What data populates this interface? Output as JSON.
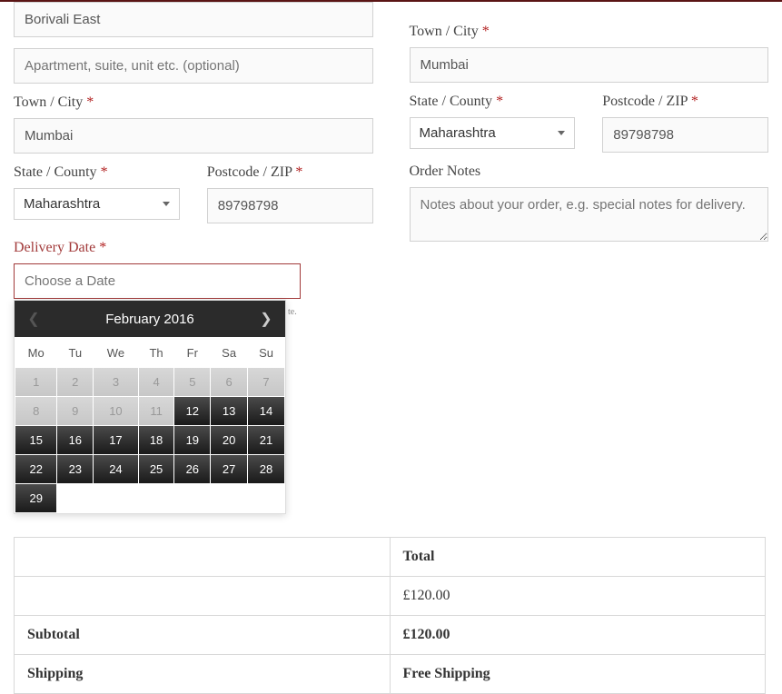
{
  "left": {
    "address1_value": "Borivali East",
    "address2_placeholder": "Apartment, suite, unit etc. (optional)",
    "city_label": "Town / City",
    "city_value": "Mumbai",
    "state_label": "State / County",
    "state_value": "Maharashtra",
    "postcode_label": "Postcode / ZIP",
    "postcode_value": "89798798",
    "delivery_label": "Delivery Date",
    "delivery_placeholder": "Choose a Date",
    "hint_suffix": "te."
  },
  "right": {
    "city_label": "Town / City",
    "city_value": "Mumbai",
    "state_label": "State / County",
    "state_value": "Maharashtra",
    "postcode_label": "Postcode / ZIP",
    "postcode_value": "89798798",
    "notes_label": "Order Notes",
    "notes_placeholder": "Notes about your order, e.g. special notes for delivery."
  },
  "datepicker": {
    "title": "February 2016",
    "weekdays": [
      "Mo",
      "Tu",
      "We",
      "Th",
      "Fr",
      "Sa",
      "Su"
    ],
    "weeks": [
      [
        {
          "d": "1",
          "s": "disabled"
        },
        {
          "d": "2",
          "s": "disabled"
        },
        {
          "d": "3",
          "s": "disabled"
        },
        {
          "d": "4",
          "s": "disabled"
        },
        {
          "d": "5",
          "s": "disabled"
        },
        {
          "d": "6",
          "s": "disabled"
        },
        {
          "d": "7",
          "s": "disabled"
        }
      ],
      [
        {
          "d": "8",
          "s": "disabled"
        },
        {
          "d": "9",
          "s": "disabled"
        },
        {
          "d": "10",
          "s": "disabled"
        },
        {
          "d": "11",
          "s": "disabled"
        },
        {
          "d": "12",
          "s": "enabled"
        },
        {
          "d": "13",
          "s": "enabled"
        },
        {
          "d": "14",
          "s": "enabled"
        }
      ],
      [
        {
          "d": "15",
          "s": "enabled"
        },
        {
          "d": "16",
          "s": "enabled"
        },
        {
          "d": "17",
          "s": "enabled"
        },
        {
          "d": "18",
          "s": "enabled"
        },
        {
          "d": "19",
          "s": "enabled"
        },
        {
          "d": "20",
          "s": "enabled"
        },
        {
          "d": "21",
          "s": "enabled"
        }
      ],
      [
        {
          "d": "22",
          "s": "enabled"
        },
        {
          "d": "23",
          "s": "enabled"
        },
        {
          "d": "24",
          "s": "enabled"
        },
        {
          "d": "25",
          "s": "enabled"
        },
        {
          "d": "26",
          "s": "enabled"
        },
        {
          "d": "27",
          "s": "enabled"
        },
        {
          "d": "28",
          "s": "enabled"
        }
      ],
      [
        {
          "d": "29",
          "s": "enabled"
        },
        {
          "d": "",
          "s": "empty"
        },
        {
          "d": "",
          "s": "empty"
        },
        {
          "d": "",
          "s": "empty"
        },
        {
          "d": "",
          "s": "empty"
        },
        {
          "d": "",
          "s": "empty"
        },
        {
          "d": "",
          "s": "empty"
        }
      ]
    ]
  },
  "order": {
    "header_total": "Total",
    "row1_total": "£120.00",
    "subtotal_label": "Subtotal",
    "subtotal_value": "£120.00",
    "shipping_label": "Shipping",
    "shipping_value": "Free Shipping"
  },
  "asterisk": "*"
}
